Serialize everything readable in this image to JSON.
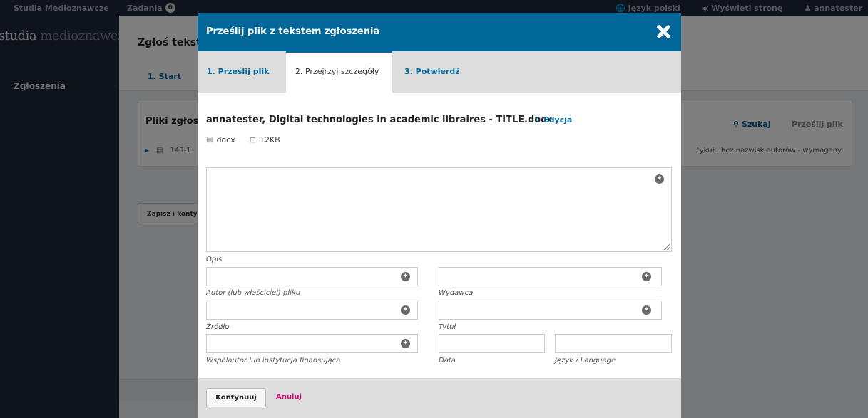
{
  "topbar": {
    "site_name": "Studia Medioznawcze",
    "tasks_label": "Zadania",
    "tasks_count": "0",
    "language": "Język polski",
    "view_site": "Wyświetl stronę",
    "user": "annatester"
  },
  "sidebar": {
    "logo_dark": "studia",
    "logo_light": " medioznawcze",
    "nav_submissions": "Zgłoszenia"
  },
  "main": {
    "title": "Zgłoś tekst",
    "tab_start": "1. Start",
    "panel_title": "Pliki zgłos",
    "row_file": "149-1",
    "row_right": "tykułu bez nazwisk autorów - wymagany",
    "search_label": "Szukaj",
    "upload_label": "Prześlij plik",
    "save_button": "Zapisz i konty"
  },
  "modal": {
    "title": "Prześlij plik z tekstem zgłoszenia",
    "tabs": [
      {
        "label": "1. Prześlij plik"
      },
      {
        "label": "2. Przejrzyj szczegóły"
      },
      {
        "label": "3. Potwierdź"
      }
    ],
    "file_title": "annatester, Digital technologies in academic libraires - TITLE.docx",
    "edit_label": "Edycja",
    "file_type": "docx",
    "file_size": "12KB",
    "description_label": "Opis",
    "description_value": "",
    "fields": {
      "creator": {
        "label": "Autor (lub właściciel) pliku",
        "value": ""
      },
      "publisher": {
        "label": "Wydawca",
        "value": ""
      },
      "source": {
        "label": "Źródło",
        "value": ""
      },
      "title": {
        "label": "Tytuł",
        "value": ""
      },
      "sponsor": {
        "label": "Współautor lub instytucja finansująca",
        "value": ""
      },
      "date": {
        "label": "Data",
        "value": ""
      },
      "language": {
        "label": "Język / Language",
        "value": ""
      }
    },
    "continue_button": "Kontynuuj",
    "cancel_button": "Anuluj"
  },
  "colors": {
    "primary": "#006798",
    "cancel": "#d00a6c",
    "sidebar": "#1e2736"
  }
}
